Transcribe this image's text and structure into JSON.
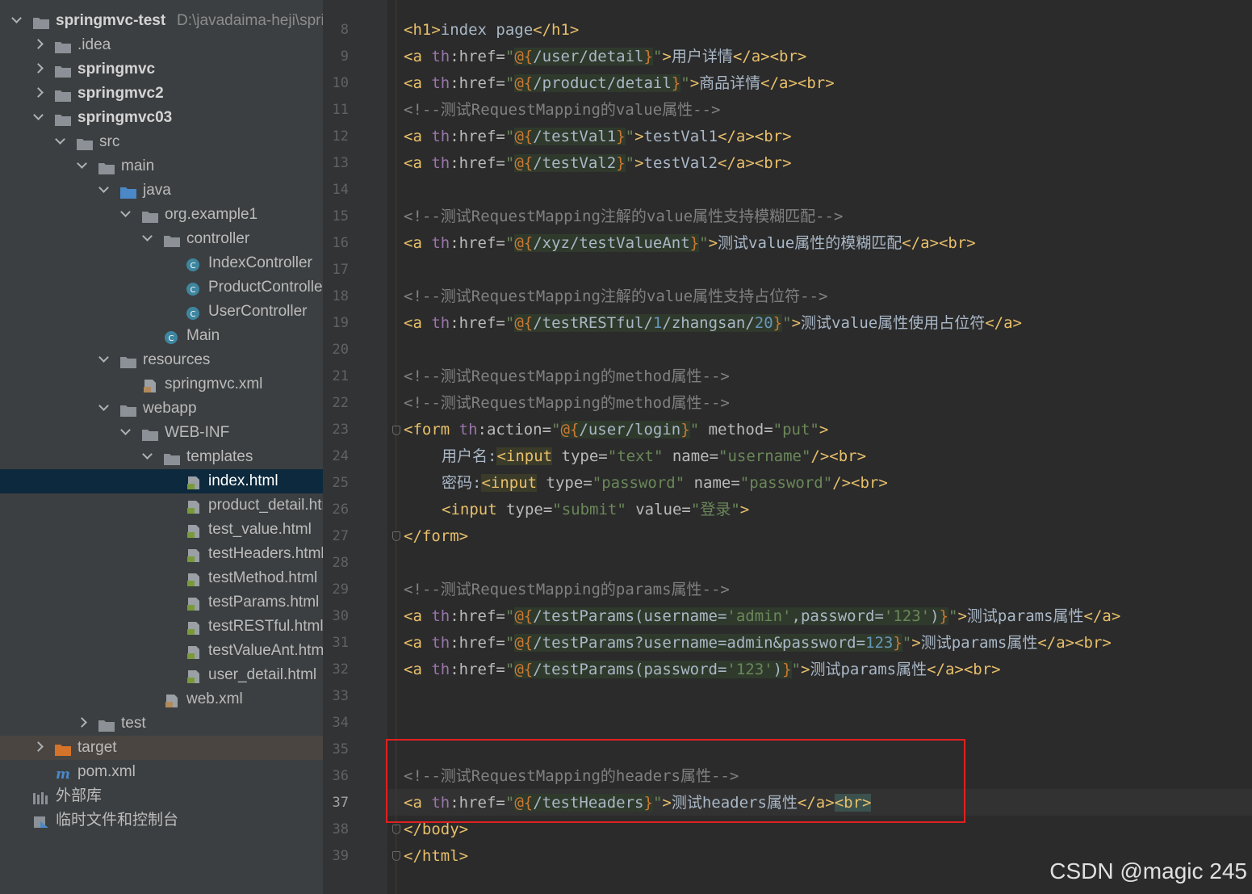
{
  "project_tree": {
    "root": {
      "name": "springmvc-test",
      "path": "D:\\javadaima-heji\\spring"
    },
    "items": [
      {
        "label": "springmvc-test",
        "icon": "module-folder-icon",
        "expanded": true
      },
      {
        "label": ".idea",
        "icon": "folder-icon",
        "expanded": false
      },
      {
        "label": "springmvc",
        "icon": "module-folder-icon",
        "expanded": false
      },
      {
        "label": "springmvc2",
        "icon": "module-folder-icon",
        "expanded": false
      },
      {
        "label": "springmvc03",
        "icon": "module-folder-icon",
        "expanded": true
      },
      {
        "label": "src",
        "icon": "folder-icon",
        "expanded": true
      },
      {
        "label": "main",
        "icon": "folder-icon",
        "expanded": true
      },
      {
        "label": "java",
        "icon": "source-folder-icon",
        "expanded": true
      },
      {
        "label": "org.example1",
        "icon": "package-icon",
        "expanded": true
      },
      {
        "label": "controller",
        "icon": "package-icon",
        "expanded": true
      },
      {
        "label": "IndexController",
        "icon": "class-icon"
      },
      {
        "label": "ProductController",
        "icon": "class-icon"
      },
      {
        "label": "UserController",
        "icon": "class-icon"
      },
      {
        "label": "Main",
        "icon": "main-class-icon"
      },
      {
        "label": "resources",
        "icon": "resources-folder-icon",
        "expanded": true
      },
      {
        "label": "springmvc.xml",
        "icon": "spring-xml-icon"
      },
      {
        "label": "webapp",
        "icon": "web-folder-icon",
        "expanded": true
      },
      {
        "label": "WEB-INF",
        "icon": "folder-icon",
        "expanded": true
      },
      {
        "label": "templates",
        "icon": "folder-icon",
        "expanded": true
      },
      {
        "label": "index.html",
        "icon": "html-file-icon",
        "selected": true
      },
      {
        "label": "product_detail.html",
        "icon": "html-file-icon"
      },
      {
        "label": "test_value.html",
        "icon": "html-file-icon"
      },
      {
        "label": "testHeaders.html",
        "icon": "html-file-icon"
      },
      {
        "label": "testMethod.html",
        "icon": "html-file-icon"
      },
      {
        "label": "testParams.html",
        "icon": "html-file-icon"
      },
      {
        "label": "testRESTful.html",
        "icon": "html-file-icon"
      },
      {
        "label": "testValueAnt.html",
        "icon": "html-file-icon"
      },
      {
        "label": "user_detail.html",
        "icon": "html-file-icon"
      },
      {
        "label": "web.xml",
        "icon": "xml-file-icon"
      },
      {
        "label": "test",
        "icon": "folder-icon",
        "expanded": false
      },
      {
        "label": "target",
        "icon": "excluded-folder-icon",
        "expanded": false
      },
      {
        "label": "pom.xml",
        "icon": "maven-icon"
      },
      {
        "label": "外部库",
        "icon": "library-icon"
      },
      {
        "label": "临时文件和控制台",
        "icon": "scratch-icon"
      }
    ]
  },
  "editor": {
    "current_line": 37,
    "lines": [
      {
        "n": "8"
      },
      {
        "n": "9"
      },
      {
        "n": "10"
      },
      {
        "n": "11"
      },
      {
        "n": "12"
      },
      {
        "n": "13"
      },
      {
        "n": "14"
      },
      {
        "n": "15"
      },
      {
        "n": "16"
      },
      {
        "n": "17"
      },
      {
        "n": "18"
      },
      {
        "n": "19"
      },
      {
        "n": "20"
      },
      {
        "n": "21"
      },
      {
        "n": "22"
      },
      {
        "n": "23"
      },
      {
        "n": "24"
      },
      {
        "n": "25"
      },
      {
        "n": "26"
      },
      {
        "n": "27"
      },
      {
        "n": "28"
      },
      {
        "n": "29"
      },
      {
        "n": "30"
      },
      {
        "n": "31"
      },
      {
        "n": "32"
      },
      {
        "n": "33"
      },
      {
        "n": "34"
      },
      {
        "n": "35"
      },
      {
        "n": "36"
      },
      {
        "n": "37"
      },
      {
        "n": "38"
      },
      {
        "n": "39"
      }
    ],
    "code": {
      "l8": {
        "open": "<h1>",
        "text": "index page",
        "close": "</h1>"
      },
      "l9": {
        "a": "<a ",
        "ns": "th",
        "attr": ":href=",
        "q1": "\"",
        "e1": "@{",
        "path": "/user/detail",
        "e2": "}",
        "q2": "\"",
        "gt": ">",
        "text": "用户详情",
        "close": "</a><br>"
      },
      "l10": {
        "a": "<a ",
        "ns": "th",
        "attr": ":href=",
        "q1": "\"",
        "e1": "@{",
        "path": "/product/detail",
        "e2": "}",
        "q2": "\"",
        "gt": ">",
        "text": "商品详情",
        "close": "</a><br>"
      },
      "l11": {
        "comment": "<!--测试RequestMapping的value属性-->"
      },
      "l12": {
        "a": "<a ",
        "ns": "th",
        "attr": ":href=",
        "q1": "\"",
        "e1": "@{",
        "path": "/testVal1",
        "e2": "}",
        "q2": "\"",
        "gt": ">",
        "text": "testVal1",
        "close": "</a><br>"
      },
      "l13": {
        "a": "<a ",
        "ns": "th",
        "attr": ":href=",
        "q1": "\"",
        "e1": "@{",
        "path": "/testVal2",
        "e2": "}",
        "q2": "\"",
        "gt": ">",
        "text": "testVal2",
        "close": "</a><br>"
      },
      "l15": {
        "comment": "<!--测试RequestMapping注解的value属性支持模糊匹配-->"
      },
      "l16": {
        "a": "<a ",
        "ns": "th",
        "attr": ":href=",
        "q1": "\"",
        "e1": "@{",
        "path": "/xyz/testValueAnt",
        "e2": "}",
        "q2": "\"",
        "gt": ">",
        "text": "测试value属性的模糊匹配",
        "close": "</a><br>"
      },
      "l18": {
        "comment": "<!--测试RequestMapping注解的value属性支持占位符-->"
      },
      "l19": {
        "a": "<a ",
        "ns": "th",
        "attr": ":href=",
        "q1": "\"",
        "e1": "@{",
        "p1": "/testRESTful/",
        "n1": "1",
        "p2": "/zhangsan/",
        "n2": "20",
        "e2": "}",
        "q2": "\"",
        "gt": ">",
        "text": "测试value属性使用占位符",
        "close": "</a>"
      },
      "l21": {
        "comment": "<!--测试RequestMapping的method属性-->"
      },
      "l22": {
        "comment": "<!--测试RequestMapping的method属性-->"
      },
      "l23": {
        "open": "<form ",
        "ns": "th",
        "attr": ":action=",
        "q1": "\"",
        "e1": "@{",
        "path": "/user/login",
        "e2": "}",
        "q2": "\"",
        "attr2": " method=",
        "val2": "\"put\"",
        "gt": ">"
      },
      "l24": {
        "label": "用户名:",
        "lt": "<",
        "input": "input",
        "attrs": " type=",
        "v1": "\"text\"",
        "attrs2": " name=",
        "v2": "\"username\"",
        "close": "/><br>"
      },
      "l25": {
        "label": "密码:",
        "lt": "<",
        "input": "input",
        "attrs": " type=",
        "v1": "\"password\"",
        "attrs2": " name=",
        "v2": "\"password\"",
        "close": "/><br>"
      },
      "l26": {
        "open": "<input",
        "attrs": " type=",
        "v1": "\"submit\"",
        "attrs2": " value=",
        "v2": "\"登录\"",
        "close": ">"
      },
      "l27": {
        "close": "</form>"
      },
      "l29": {
        "comment": "<!--测试RequestMapping的params属性-->"
      },
      "l30": {
        "a": "<a ",
        "ns": "th",
        "attr": ":href=",
        "q1": "\"",
        "e1": "@{",
        "p1": "/testParams(username=",
        "s1": "'admin'",
        "p2": ",password=",
        "s2": "'123'",
        "p3": ")",
        "e2": "}",
        "q2": "\"",
        "gt": ">",
        "text": "测试params属性",
        "close": "</a>"
      },
      "l31": {
        "a": "<a ",
        "ns": "th",
        "attr": ":href=",
        "q1": "\"",
        "e1": "@{",
        "path": "/testParams?username=admin&password=",
        "n1": "123",
        "e2": "}",
        "q2": "\"",
        "gt": ">",
        "text": "测试params属性",
        "close": "</a><br>"
      },
      "l32": {
        "a": "<a ",
        "ns": "th",
        "attr": ":href=",
        "q1": "\"",
        "e1": "@{",
        "p1": "/testParams(password=",
        "s1": "'123'",
        "p2": ")",
        "e2": "}",
        "q2": "\"",
        "gt": ">",
        "text": "测试params属性",
        "close": "</a><br>"
      },
      "l36": {
        "comment": "<!--测试RequestMapping的headers属性-->"
      },
      "l37": {
        "a": "<a ",
        "ns": "th",
        "attr": ":href=",
        "q1": "\"",
        "e1": "@{",
        "path": "/testHeaders",
        "e2": "}",
        "q2": "\"",
        "gt": ">",
        "text": "测试headers属性",
        "close": "</a>",
        "br": "<br>"
      },
      "l38": {
        "close": "</body>"
      },
      "l39": {
        "close": "</html>"
      }
    }
  },
  "watermark": "CSDN @magic 245",
  "colors": {
    "accent": "#4a88c7",
    "highlight_box": "#e02020",
    "selected_row": "#0d293e"
  }
}
